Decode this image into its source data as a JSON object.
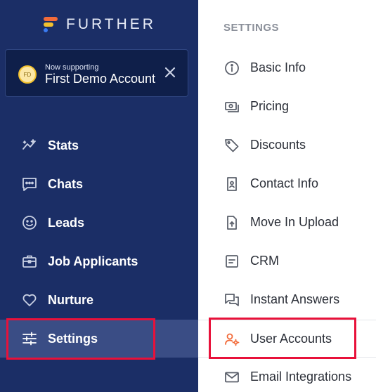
{
  "brand": {
    "name": "FURTHER"
  },
  "support": {
    "label": "Now supporting",
    "account": "First Demo Account",
    "initials": "FD"
  },
  "nav": [
    {
      "label": "Stats",
      "icon": "stats-icon"
    },
    {
      "label": "Chats",
      "icon": "chat-icon"
    },
    {
      "label": "Leads",
      "icon": "smiley-icon"
    },
    {
      "label": "Job Applicants",
      "icon": "briefcase-icon"
    },
    {
      "label": "Nurture",
      "icon": "heart-icon"
    },
    {
      "label": "Settings",
      "icon": "sliders-icon",
      "active": true
    }
  ],
  "settings": {
    "title": "SETTINGS",
    "items": [
      {
        "label": "Basic Info",
        "icon": "info-icon"
      },
      {
        "label": "Pricing",
        "icon": "money-icon"
      },
      {
        "label": "Discounts",
        "icon": "tag-icon"
      },
      {
        "label": "Contact Info",
        "icon": "contact-icon"
      },
      {
        "label": "Move In Upload",
        "icon": "upload-icon"
      },
      {
        "label": "CRM",
        "icon": "crm-icon"
      },
      {
        "label": "Instant Answers",
        "icon": "answers-icon"
      },
      {
        "label": "User Accounts",
        "icon": "user-gear-icon",
        "active": true
      },
      {
        "label": "Email Integrations",
        "icon": "mail-icon"
      }
    ]
  },
  "colors": {
    "sidebar": "#1b2e66",
    "accent": "#f26b3a",
    "highlight": "#e8113a"
  }
}
